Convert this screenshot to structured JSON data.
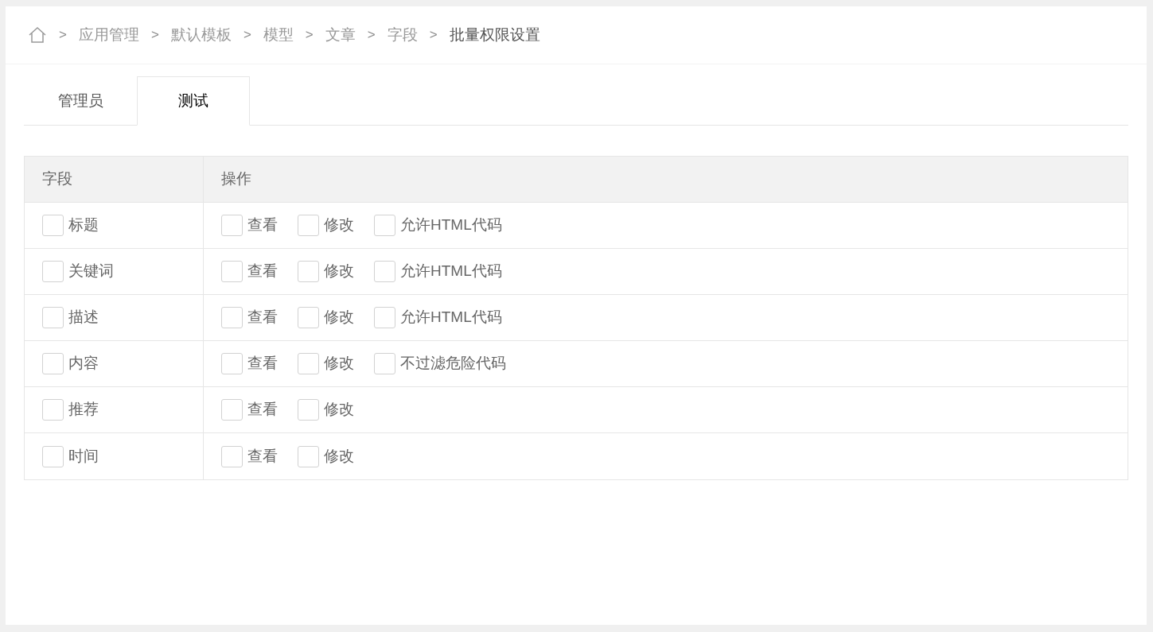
{
  "breadcrumb": [
    {
      "label": "应用管理",
      "current": false
    },
    {
      "label": "默认模板",
      "current": false
    },
    {
      "label": "模型",
      "current": false
    },
    {
      "label": "文章",
      "current": false
    },
    {
      "label": "字段",
      "current": false
    },
    {
      "label": "批量权限设置",
      "current": true
    }
  ],
  "separator": ">",
  "tabs": [
    {
      "label": "管理员",
      "selected": false
    },
    {
      "label": "测试",
      "selected": true
    }
  ],
  "table": {
    "columns": [
      "字段",
      "操作"
    ],
    "rows": [
      {
        "field": {
          "label": "标题",
          "checked": false
        },
        "actions": [
          {
            "label": "查看",
            "checked": false
          },
          {
            "label": "修改",
            "checked": false
          },
          {
            "label": "允许HTML代码",
            "checked": false
          }
        ]
      },
      {
        "field": {
          "label": "关键词",
          "checked": false
        },
        "actions": [
          {
            "label": "查看",
            "checked": false
          },
          {
            "label": "修改",
            "checked": false
          },
          {
            "label": "允许HTML代码",
            "checked": false
          }
        ]
      },
      {
        "field": {
          "label": "描述",
          "checked": false
        },
        "actions": [
          {
            "label": "查看",
            "checked": false
          },
          {
            "label": "修改",
            "checked": false
          },
          {
            "label": "允许HTML代码",
            "checked": false
          }
        ]
      },
      {
        "field": {
          "label": "内容",
          "checked": false
        },
        "actions": [
          {
            "label": "查看",
            "checked": false
          },
          {
            "label": "修改",
            "checked": false
          },
          {
            "label": "不过滤危险代码",
            "checked": false
          }
        ]
      },
      {
        "field": {
          "label": "推荐",
          "checked": false
        },
        "actions": [
          {
            "label": "查看",
            "checked": false
          },
          {
            "label": "修改",
            "checked": false
          }
        ]
      },
      {
        "field": {
          "label": "时间",
          "checked": false
        },
        "actions": [
          {
            "label": "查看",
            "checked": false
          },
          {
            "label": "修改",
            "checked": false
          }
        ]
      }
    ]
  }
}
